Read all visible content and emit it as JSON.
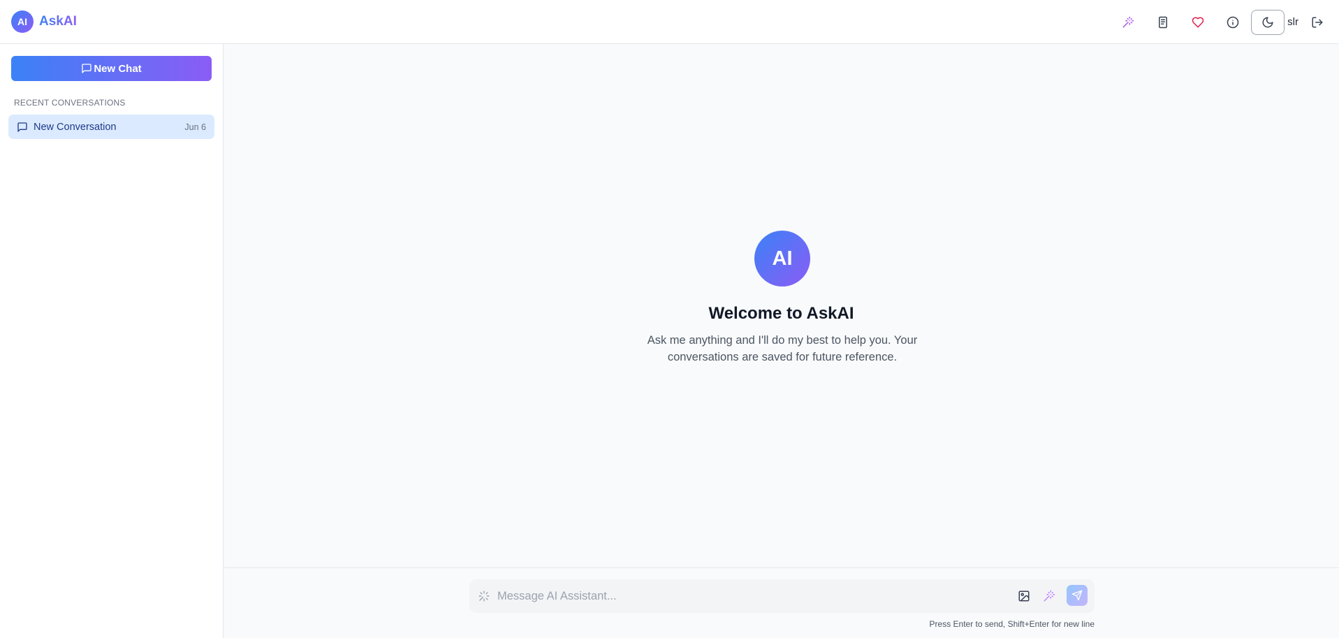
{
  "app": {
    "logo_text": "AI",
    "name": "AskAI",
    "brand_gradient": [
      "#3b82f6",
      "#8b5cf6"
    ]
  },
  "header": {
    "actions": [
      {
        "name": "magic-wand-icon",
        "color": "#a855f7"
      },
      {
        "name": "document-icon",
        "color": "#374151"
      },
      {
        "name": "heart-icon",
        "color": "#e11d48"
      },
      {
        "name": "info-icon",
        "color": "#374151"
      },
      {
        "name": "moon-icon",
        "color": "#374151"
      }
    ],
    "username": "slr",
    "logout_icon": "logout-icon"
  },
  "sidebar": {
    "new_chat_label": "New Chat",
    "section_label": "RECENT CONVERSATIONS",
    "conversations": [
      {
        "title": "New Conversation",
        "date": "Jun 6",
        "selected": true
      }
    ]
  },
  "main": {
    "avatar_text": "AI",
    "welcome_title": "Welcome to AskAI",
    "welcome_subtitle": "Ask me anything and I'll do my best to help you. Your conversations are saved for future reference."
  },
  "composer": {
    "placeholder": "Message AI Assistant...",
    "value": "",
    "hint": "Press Enter to send, Shift+Enter for new line"
  }
}
